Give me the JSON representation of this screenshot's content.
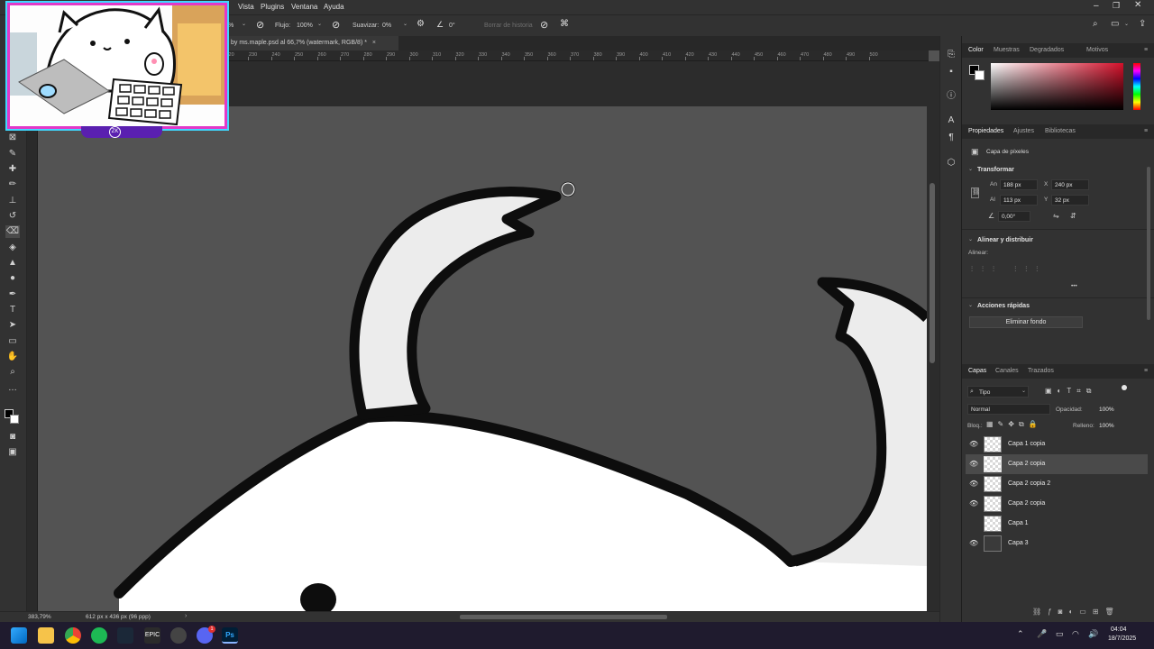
{
  "menubar": {
    "items": [
      "Vista",
      "Plugins",
      "Ventana",
      "Ayuda"
    ],
    "window_controls": [
      "minimize",
      "restore",
      "close"
    ]
  },
  "options": {
    "opacity_partial": "%",
    "flow_label": "Flujo:",
    "flow_value": "100%",
    "smoothing_label": "Suavizar:",
    "smoothing_value": "0%",
    "angle_value": "0°",
    "history_label": "Borrar de historia"
  },
  "document": {
    "tab_title": "by ms.maple.psd al 66,7% (watermark, RGB/8) *",
    "ruler_labels": [
      "200",
      "220",
      "230",
      "240",
      "250",
      "260",
      "270",
      "280",
      "290",
      "300",
      "310",
      "320",
      "330",
      "340",
      "350",
      "360",
      "370",
      "380",
      "390",
      "400",
      "410",
      "420",
      "430",
      "440",
      "450",
      "460",
      "470",
      "480",
      "490",
      "500"
    ],
    "zoom": "383,79%",
    "doc_size": "612 px x 436 px (96 ppp)"
  },
  "color_panel": {
    "tabs": [
      "Color",
      "Muestras",
      "Degradados",
      "Motivos"
    ],
    "active_tab": "Color",
    "hue_color": "#d4102a"
  },
  "properties": {
    "tabs": [
      "Propiedades",
      "Ajustes",
      "Bibliotecas"
    ],
    "layer_kind": "Capa de píxeles",
    "transform_title": "Transformar",
    "width_label": "An",
    "width": "188 px",
    "height_label": "Al",
    "height": "113 px",
    "x_label": "X",
    "x": "240 px",
    "y_label": "Y",
    "y": "32 px",
    "angle": "0,00°",
    "align_title": "Alinear y distribuir",
    "align_label": "Alinear:",
    "more": "•••",
    "quick_title": "Acciones rápidas",
    "remove_bg": "Eliminar fondo"
  },
  "layers_panel": {
    "tabs": [
      "Capas",
      "Canales",
      "Trazados"
    ],
    "filter": "Tipo",
    "blend_mode": "Normal",
    "opacity_label": "Opacidad:",
    "opacity": "100%",
    "lock_label": "Bloq.:",
    "fill_label": "Relleno:",
    "fill": "100%",
    "layers": [
      {
        "name": "Capa 1 copia",
        "visible": true,
        "selected": false
      },
      {
        "name": "Capa 2 copia",
        "visible": true,
        "selected": true
      },
      {
        "name": "Capa 2 copia 2",
        "visible": true,
        "selected": false
      },
      {
        "name": "Capa 2 copia",
        "visible": true,
        "selected": false
      },
      {
        "name": "Capa 1",
        "visible": false,
        "selected": false
      },
      {
        "name": "Capa 3",
        "visible": true,
        "selected": false
      }
    ]
  },
  "taskbar": {
    "time": "04:04",
    "date": "18/7/2025",
    "discord_badge": "1"
  },
  "webcam": {
    "overlay_badge": "ZK"
  }
}
